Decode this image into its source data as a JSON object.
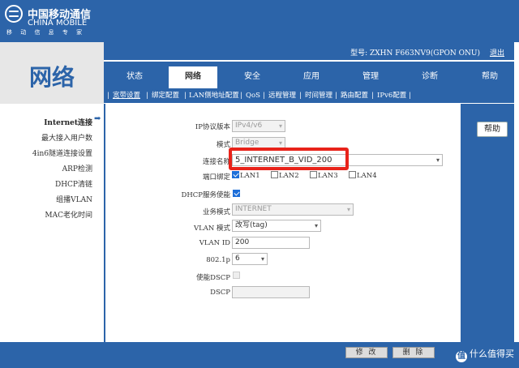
{
  "brand": {
    "name_cn": "中国移动通信",
    "name_en": "CHINA MOBILE",
    "slogan": "移 动 信 息 专 家"
  },
  "header": {
    "model_label": "型号: ZXHN F663NV9(GPON ONU)",
    "logout": "退出"
  },
  "page_title": "网络",
  "tabs": [
    {
      "label": "状态"
    },
    {
      "label": "网络"
    },
    {
      "label": "安全"
    },
    {
      "label": "应用"
    },
    {
      "label": "管理"
    },
    {
      "label": "诊断"
    },
    {
      "label": "帮助"
    }
  ],
  "active_tab": "网络",
  "subnav": [
    {
      "label": "宽带设置"
    },
    {
      "label": "绑定配置"
    },
    {
      "label": "LAN侧地址配置"
    },
    {
      "label": "QoS"
    },
    {
      "label": "远程管理"
    },
    {
      "label": "时间管理"
    },
    {
      "label": "路由配置"
    },
    {
      "label": "IPv6配置"
    }
  ],
  "left_nav": [
    {
      "label": "Internet连接"
    },
    {
      "label": "最大接入用户数"
    },
    {
      "label": "4in6隧道连接设置"
    },
    {
      "label": "ARP检测"
    },
    {
      "label": "DHCP清链"
    },
    {
      "label": "组播VLAN"
    },
    {
      "label": "MAC老化时间"
    }
  ],
  "form": {
    "ip_version": {
      "label": "IP协议版本",
      "value": "IPv4/v6"
    },
    "mode": {
      "label": "模式",
      "value": "Bridge"
    },
    "connection_name": {
      "label": "连接名称",
      "value": "5_INTERNET_B_VID_200"
    },
    "port_binding": {
      "label": "端口绑定",
      "options": [
        {
          "label": "LAN1",
          "checked": true
        },
        {
          "label": "LAN2",
          "checked": false
        },
        {
          "label": "LAN3",
          "checked": false
        },
        {
          "label": "LAN4",
          "checked": false
        }
      ]
    },
    "dhcp_enable": {
      "label": "DHCP服务使能",
      "checked": true
    },
    "service_mode": {
      "label": "业务模式",
      "value": "INTERNET"
    },
    "vlan_mode": {
      "label": "VLAN 模式",
      "value": "改写(tag)"
    },
    "vlan_id": {
      "label": "VLAN ID",
      "value": "200"
    },
    "priority": {
      "label": "802.1p",
      "value": "6"
    },
    "enable_dscp": {
      "label": "使能DSCP",
      "checked": false
    },
    "dscp": {
      "label": "DSCP",
      "value": ""
    }
  },
  "buttons": {
    "help": "帮助",
    "modify": "修 改",
    "delete": "删 除"
  },
  "watermark": {
    "badge": "值",
    "text": "什么值得买"
  },
  "colors": {
    "primary_blue": "#2c64a9",
    "highlight_red": "#e8231a",
    "checkbox_blue": "#1e6fd9"
  }
}
